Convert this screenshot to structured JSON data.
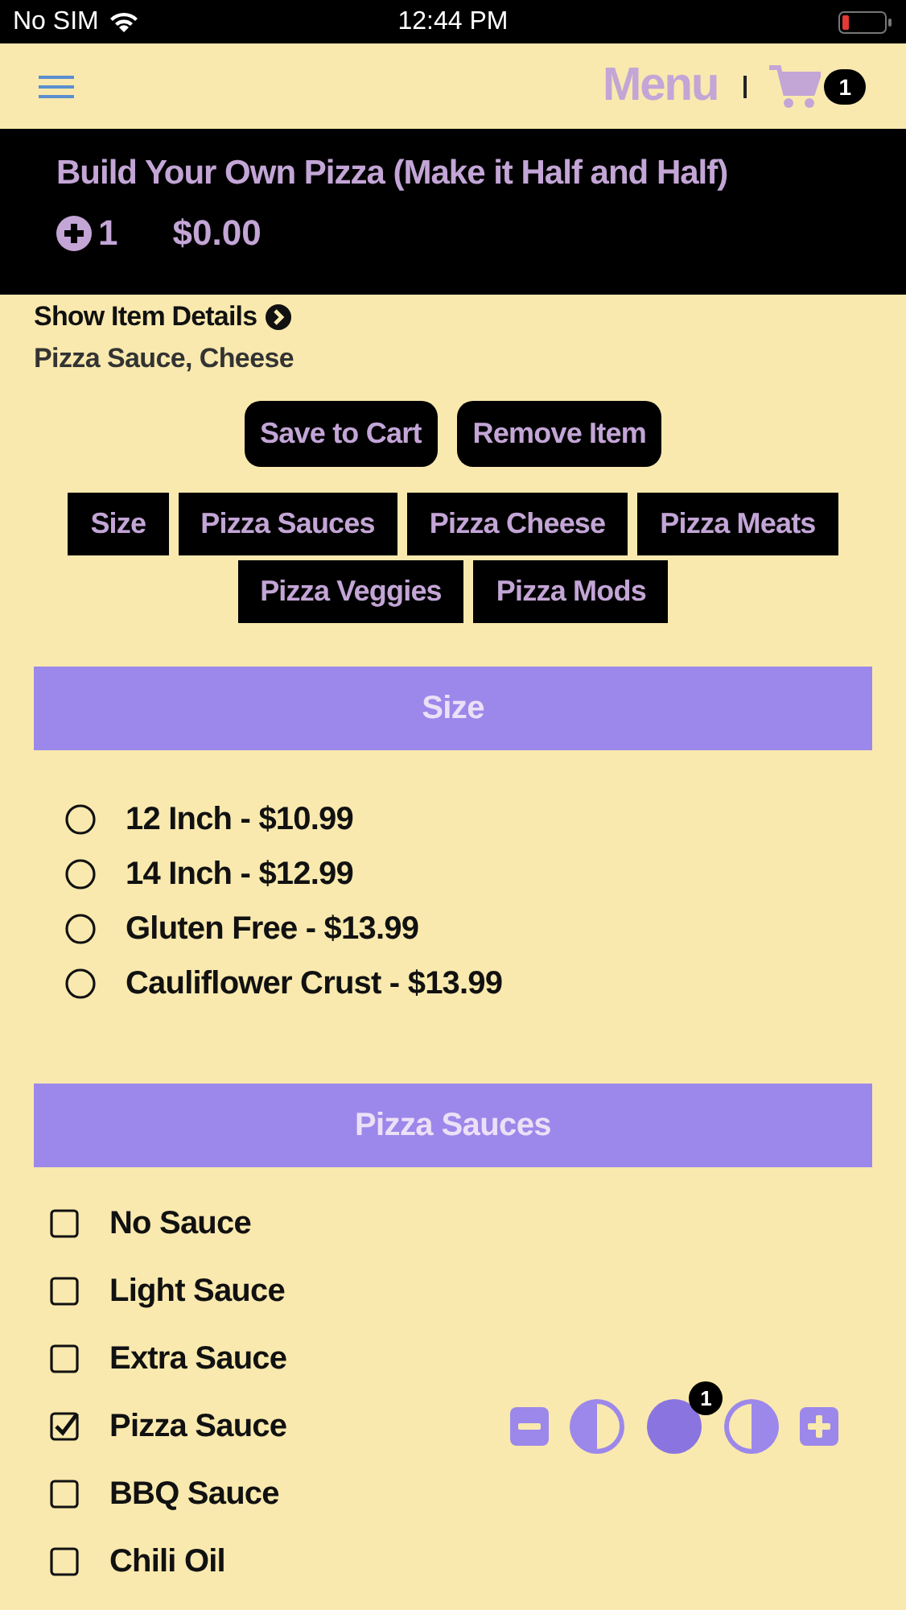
{
  "status_bar": {
    "carrier": "No SIM",
    "time": "12:44 PM"
  },
  "header": {
    "title": "Menu",
    "cart_count": "1"
  },
  "item": {
    "title": "Build Your Own Pizza (Make it Half and Half)",
    "quantity": "1",
    "price": "$0.00"
  },
  "details": {
    "link": "Show Item Details",
    "summary": "Pizza Sauce, Cheese"
  },
  "actions": [
    "Save to Cart",
    "Remove Item"
  ],
  "categories": [
    {
      "label": "Size"
    },
    {
      "label": "Pizza Sauces"
    },
    {
      "label": "Pizza Cheese"
    },
    {
      "label": "Pizza Meats"
    },
    {
      "label": "Pizza Veggies"
    },
    {
      "label": "Pizza Mods"
    }
  ],
  "sections": [
    {
      "title": "Size",
      "kind": "radio",
      "options": [
        {
          "label": "12 Inch - $10.99",
          "checked": false
        },
        {
          "label": "14 Inch - $12.99",
          "checked": false
        },
        {
          "label": "Gluten Free - $13.99",
          "checked": false
        },
        {
          "label": "Cauliflower Crust - $13.99",
          "checked": false
        }
      ]
    },
    {
      "title": "Pizza Sauces",
      "kind": "checkbox",
      "options": [
        {
          "label": "No Sauce",
          "checked": false
        },
        {
          "label": "Light Sauce",
          "checked": false
        },
        {
          "label": "Extra Sauce",
          "checked": false
        },
        {
          "label": "Pizza Sauce",
          "checked": true,
          "portions": [
            {
              "kind": "left",
              "selected": false
            },
            {
              "kind": "whole",
              "selected": true,
              "badge": "1"
            },
            {
              "kind": "right",
              "selected": false
            }
          ]
        },
        {
          "label": "BBQ Sauce",
          "checked": false
        },
        {
          "label": "Chili Oil",
          "checked": false
        }
      ]
    }
  ]
}
